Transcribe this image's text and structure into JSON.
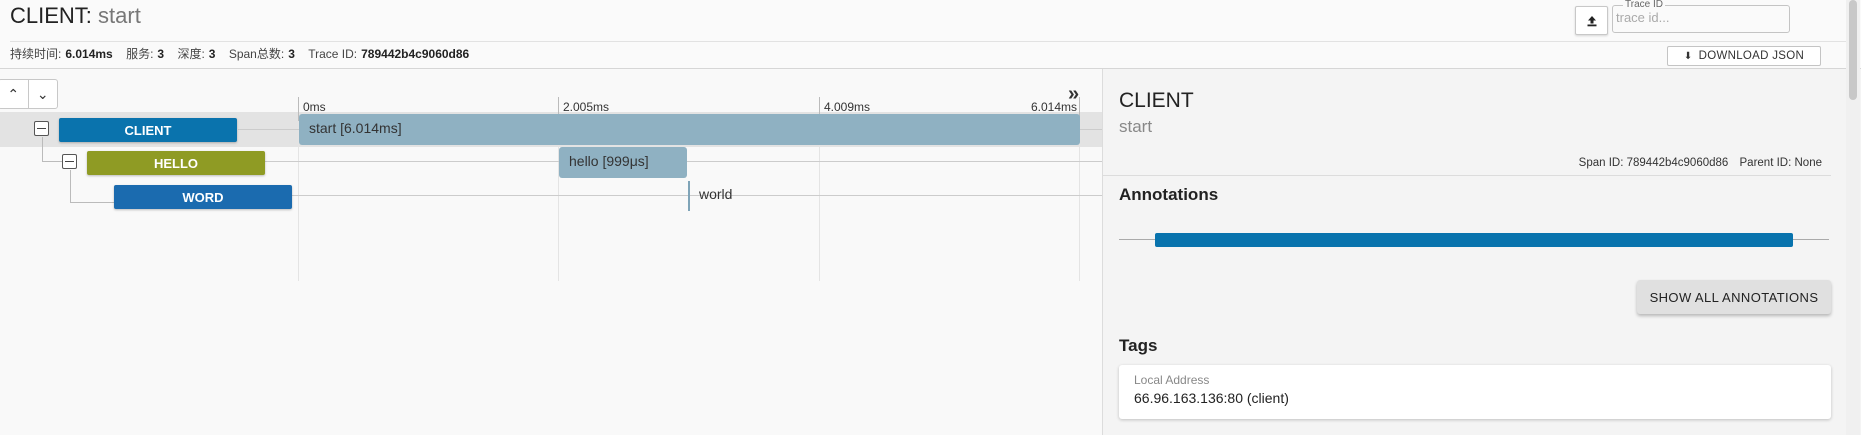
{
  "header": {
    "service": "CLIENT",
    "separator": ":",
    "span_name": "start",
    "meta": [
      {
        "label": "持续时间:",
        "value": "6.014ms"
      },
      {
        "label": "服务:",
        "value": "3"
      },
      {
        "label": "深度:",
        "value": "3"
      },
      {
        "label": "Span总数:",
        "value": "3"
      },
      {
        "label": "Trace ID:",
        "value": "789442b4c9060d86"
      }
    ],
    "trace_id_legend": "Trace ID",
    "trace_id_placeholder": "trace id...",
    "download_label": "DOWNLOAD JSON"
  },
  "timeline": {
    "ticks": [
      "0ms",
      "2.005ms",
      "4.009ms",
      "6.014ms"
    ],
    "spans": [
      {
        "service": "CLIENT",
        "name": "start [6.014ms]",
        "color": "#0a73ad",
        "bar_color": "#8fb1c2"
      },
      {
        "service": "HELLO",
        "name": "hello [999μs]",
        "color": "#8f9b24",
        "bar_color": "#8fb1c2"
      },
      {
        "service": "WORD",
        "name": "world",
        "color": "#1b6baf",
        "bar_color": "#7fa4b8"
      }
    ]
  },
  "detail": {
    "service": "CLIENT",
    "span_name": "start",
    "span_id_label": "Span ID:",
    "span_id": "789442b4c9060d86",
    "parent_id_label": "Parent ID:",
    "parent_id": "None",
    "annotations_title": "Annotations",
    "show_all_label": "SHOW ALL ANNOTATIONS",
    "tags_title": "Tags",
    "tags": [
      {
        "key": "Local Address",
        "value": "66.96.163.136:80 (client)"
      }
    ]
  }
}
